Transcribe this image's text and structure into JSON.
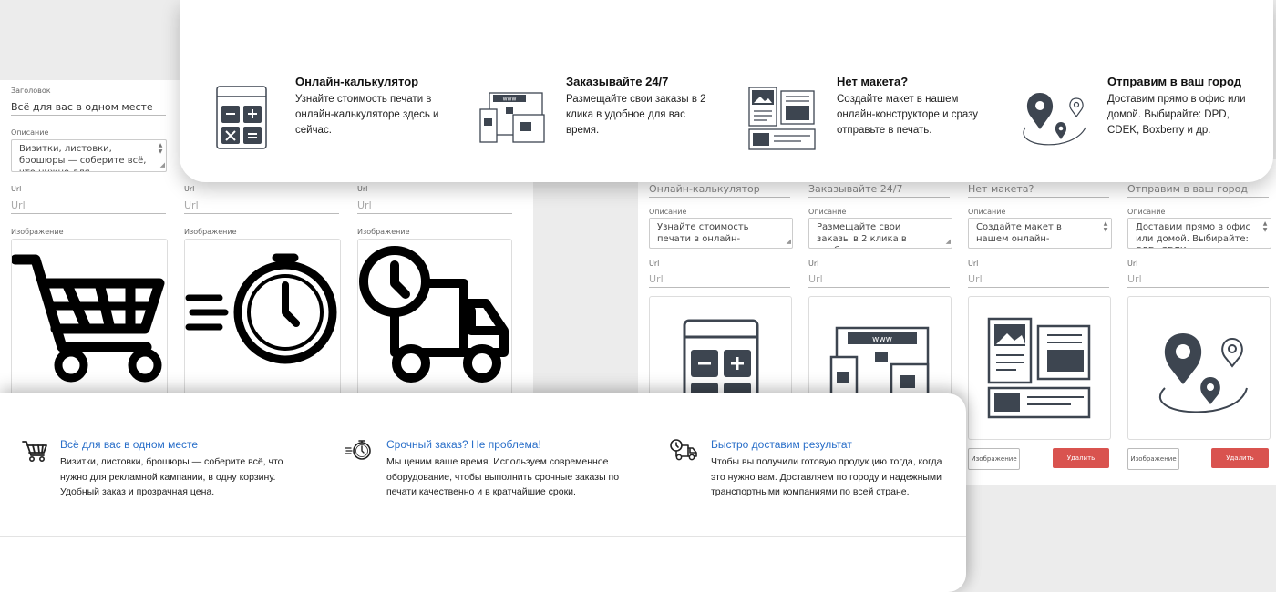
{
  "left_form": {
    "heading_label": "Заголовок",
    "heading_value": "Всё для вас в одном месте",
    "desc_label": "Описание",
    "desc_value": "Визитки, листовки, брошюры — соберите всё, что нужно для",
    "url_label": "Url",
    "url_placeholder": "Url",
    "image_label": "Изображение"
  },
  "right_form": {
    "columns": [
      {
        "title": "Онлайн-калькулятор",
        "desc": "Узнайте стоимость печати в онлайн-калькуляторе здесь и"
      },
      {
        "title": "Заказывайте 24/7",
        "desc": "Размещайте свои заказы в 2 клика в удобное для вас время."
      },
      {
        "title": "Нет макета?",
        "desc": "Создайте макет в нашем онлайн-конструкторе и сразу"
      },
      {
        "title": "Отправим в ваш город",
        "desc": "Доставим прямо в офис или домой. Выбирайте: DPD, CDEK,"
      }
    ],
    "desc_label": "Описание",
    "url_label": "Url",
    "url_placeholder": "Url",
    "image_button": "Изображение",
    "delete_button": "Удалить"
  },
  "features": [
    {
      "icon": "calculator-icon",
      "title": "Онлайн-калькулятор",
      "text": "Узнайте стоимость печати в онлайн-калькуляторе здесь и сейчас."
    },
    {
      "icon": "devices-icon",
      "title": "Заказывайте 24/7",
      "text": "Размещайте свои заказы в 2 клика в удобное для вас время."
    },
    {
      "icon": "layout-icon",
      "title": "Нет макета?",
      "text": "Создайте макет в нашем онлайн-конструкторе и сразу отправьте в печать."
    },
    {
      "icon": "map-pin-icon",
      "title": "Отправим в ваш город",
      "text": "Доставим прямо в офис или домой. Выбирайте: DPD, CDEK, Boxberry и др."
    }
  ],
  "benefits": [
    {
      "icon": "cart-icon",
      "title": "Всё для вас в одном месте",
      "text": "Визитки, листовки, брошюры — соберите всё, что нужно для рекламной кампании, в одну корзину. Удобный заказ и прозрачная цена."
    },
    {
      "icon": "stopwatch-icon",
      "title": "Срочный заказ? Не проблема!",
      "text": "Мы ценим ваше время. Используем современное оборудование, чтобы выполнить срочные заказы по печати качественно и в кратчайшие сроки."
    },
    {
      "icon": "truck-icon",
      "title": "Быстро доставим результат",
      "text": "Чтобы вы получили готовую продукцию тогда, когда это нужно вам. Доставляем по городу и надежными транспортными компаниями по всей стране."
    }
  ],
  "colors": {
    "accent_blue": "#2a6fc9",
    "delete_red": "#d9534f",
    "icon_dark": "#3d4550"
  }
}
